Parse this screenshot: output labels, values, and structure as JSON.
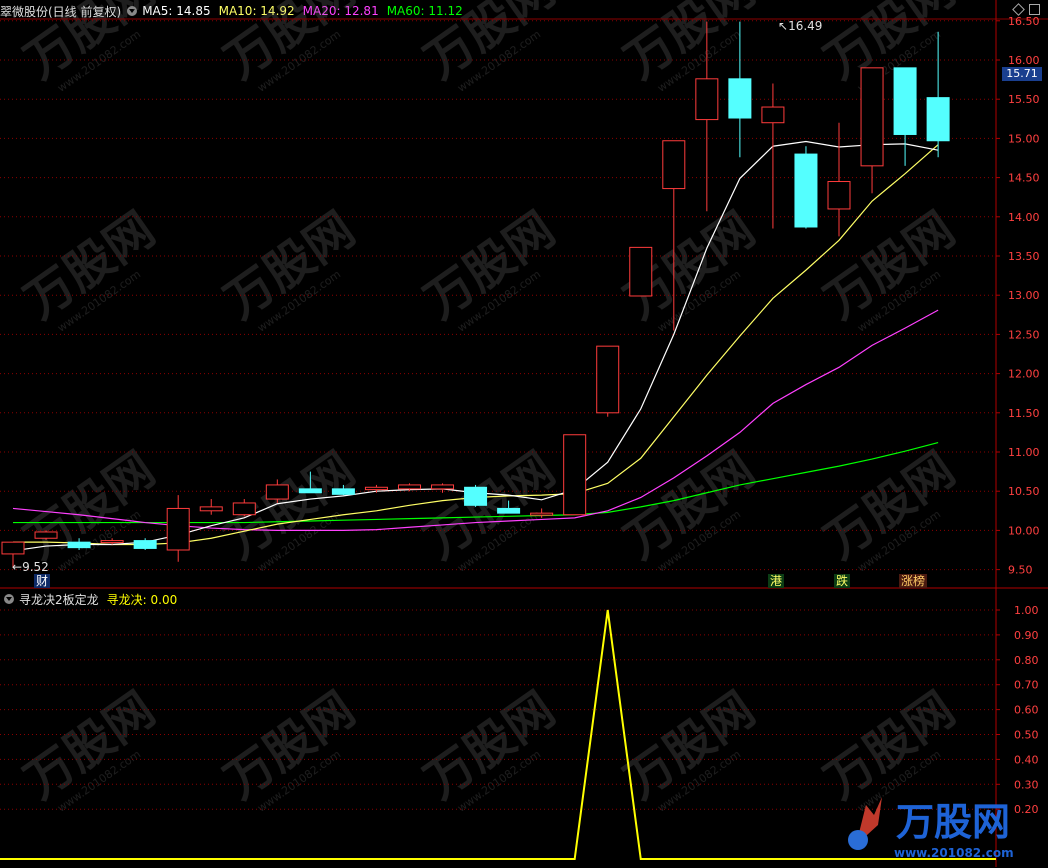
{
  "main_header": {
    "stock_label": "翠微股份(日线 前复权)",
    "ma5": "MA5: 14.85",
    "ma10": "MA10: 14.92",
    "ma20": "MA20: 12.81",
    "ma60": "MA60: 11.12"
  },
  "sub_header": {
    "indicator_name": "寻龙决2板定龙",
    "indicator_value": "寻龙决: 0.00"
  },
  "price_axis": {
    "ticks": [
      "16.50",
      "16.00",
      "15.50",
      "15.00",
      "14.50",
      "14.00",
      "13.50",
      "13.00",
      "12.50",
      "12.00",
      "11.50",
      "11.00",
      "10.50",
      "10.00",
      "9.50"
    ],
    "current_price": "15.71"
  },
  "indicator_axis": {
    "ticks": [
      "1.00",
      "0.90",
      "0.80",
      "0.70",
      "0.60",
      "0.50",
      "0.40",
      "0.30",
      "0.20"
    ]
  },
  "annotations": {
    "high_label": "16.49",
    "low_label": "9.52",
    "event_cai": "财",
    "event_gang": "港",
    "event_die": "跌",
    "event_zhangbang": "涨榜"
  },
  "watermark": {
    "brand": "万股网",
    "url": "www.201082.com"
  },
  "colors": {
    "up": "#ff3c3c",
    "down": "#54ffff",
    "ma5": "#ffffff",
    "ma10": "#ffff66",
    "ma20": "#ff40ff",
    "ma60": "#00ff00",
    "indicator": "#ffff00",
    "grid": "#8b0000"
  },
  "chart_data": [
    {
      "type": "candlestick",
      "title": "翠微股份(日线 前复权)",
      "ylim": [
        9.35,
        16.6
      ],
      "candles": [
        {
          "o": 9.7,
          "h": 9.85,
          "l": 9.52,
          "c": 9.85
        },
        {
          "o": 9.9,
          "h": 10.0,
          "l": 9.88,
          "c": 9.98
        },
        {
          "o": 9.85,
          "h": 9.9,
          "l": 9.75,
          "c": 9.78
        },
        {
          "o": 9.85,
          "h": 9.9,
          "l": 9.82,
          "c": 9.87
        },
        {
          "o": 9.87,
          "h": 9.9,
          "l": 9.75,
          "c": 9.77
        },
        {
          "o": 9.75,
          "h": 10.45,
          "l": 9.6,
          "c": 10.28
        },
        {
          "o": 10.25,
          "h": 10.4,
          "l": 10.2,
          "c": 10.3
        },
        {
          "o": 10.2,
          "h": 10.4,
          "l": 10.18,
          "c": 10.35
        },
        {
          "o": 10.4,
          "h": 10.65,
          "l": 10.35,
          "c": 10.58
        },
        {
          "o": 10.53,
          "h": 10.75,
          "l": 10.48,
          "c": 10.48
        },
        {
          "o": 10.53,
          "h": 10.58,
          "l": 10.45,
          "c": 10.46
        },
        {
          "o": 10.52,
          "h": 10.58,
          "l": 10.48,
          "c": 10.55
        },
        {
          "o": 10.53,
          "h": 10.6,
          "l": 10.5,
          "c": 10.58
        },
        {
          "o": 10.53,
          "h": 10.6,
          "l": 10.48,
          "c": 10.58
        },
        {
          "o": 10.55,
          "h": 10.58,
          "l": 10.3,
          "c": 10.32
        },
        {
          "o": 10.28,
          "h": 10.38,
          "l": 10.22,
          "c": 10.22
        },
        {
          "o": 10.2,
          "h": 10.28,
          "l": 10.16,
          "c": 10.22
        },
        {
          "o": 10.2,
          "h": 11.22,
          "l": 10.2,
          "c": 11.22
        },
        {
          "o": 11.5,
          "h": 12.35,
          "l": 11.45,
          "c": 12.35
        },
        {
          "o": 12.99,
          "h": 13.61,
          "l": 12.99,
          "c": 13.61
        },
        {
          "o": 14.36,
          "h": 14.97,
          "l": 12.55,
          "c": 14.97
        },
        {
          "o": 15.24,
          "h": 16.49,
          "l": 14.07,
          "c": 15.76
        },
        {
          "o": 15.76,
          "h": 16.49,
          "l": 14.76,
          "c": 15.26
        },
        {
          "o": 15.2,
          "h": 15.7,
          "l": 13.85,
          "c": 15.4
        },
        {
          "o": 14.8,
          "h": 14.9,
          "l": 13.85,
          "c": 13.87
        },
        {
          "o": 14.1,
          "h": 15.2,
          "l": 13.75,
          "c": 14.45
        },
        {
          "o": 14.65,
          "h": 15.9,
          "l": 14.3,
          "c": 15.9
        },
        {
          "o": 15.9,
          "h": 15.9,
          "l": 14.65,
          "c": 15.05
        },
        {
          "o": 15.52,
          "h": 16.36,
          "l": 14.76,
          "c": 14.97
        }
      ],
      "ma5": [
        9.74,
        9.8,
        9.82,
        9.82,
        9.85,
        9.94,
        10.06,
        10.16,
        10.34,
        10.4,
        10.44,
        10.5,
        10.52,
        10.53,
        10.48,
        10.45,
        10.39,
        10.52,
        10.87,
        11.55,
        12.5,
        13.6,
        14.49,
        14.9,
        14.96,
        14.89,
        14.92,
        14.93,
        14.85
      ],
      "ma10": [
        9.85,
        9.85,
        9.84,
        9.82,
        9.82,
        9.84,
        9.9,
        9.99,
        10.08,
        10.14,
        10.2,
        10.25,
        10.32,
        10.38,
        10.42,
        10.44,
        10.45,
        10.47,
        10.6,
        10.92,
        11.45,
        11.98,
        12.48,
        12.96,
        13.32,
        13.7,
        14.2,
        14.55,
        14.92
      ],
      "ma20": [
        10.28,
        10.24,
        10.2,
        10.15,
        10.1,
        10.06,
        10.03,
        10.01,
        10.0,
        10.0,
        10.0,
        10.01,
        10.04,
        10.07,
        10.1,
        10.12,
        10.14,
        10.16,
        10.25,
        10.42,
        10.67,
        10.95,
        11.25,
        11.62,
        11.86,
        12.08,
        12.36,
        12.58,
        12.81
      ],
      "ma60": [
        10.1,
        10.1,
        10.1,
        10.1,
        10.1,
        10.1,
        10.1,
        10.1,
        10.11,
        10.12,
        10.13,
        10.14,
        10.15,
        10.16,
        10.17,
        10.18,
        10.19,
        10.2,
        10.23,
        10.3,
        10.38,
        10.48,
        10.58,
        10.66,
        10.74,
        10.82,
        10.91,
        11.01,
        11.12
      ]
    },
    {
      "type": "line",
      "title": "寻龙决2板定龙",
      "series": [
        {
          "name": "寻龙决",
          "values": [
            0,
            0,
            0,
            0,
            0,
            0,
            0,
            0,
            0,
            0,
            0,
            0,
            0,
            0,
            0,
            0,
            0,
            0,
            1,
            0,
            0,
            0,
            0,
            0,
            0,
            0,
            0,
            0,
            0
          ]
        }
      ],
      "ylim": [
        0,
        1.0
      ]
    }
  ]
}
